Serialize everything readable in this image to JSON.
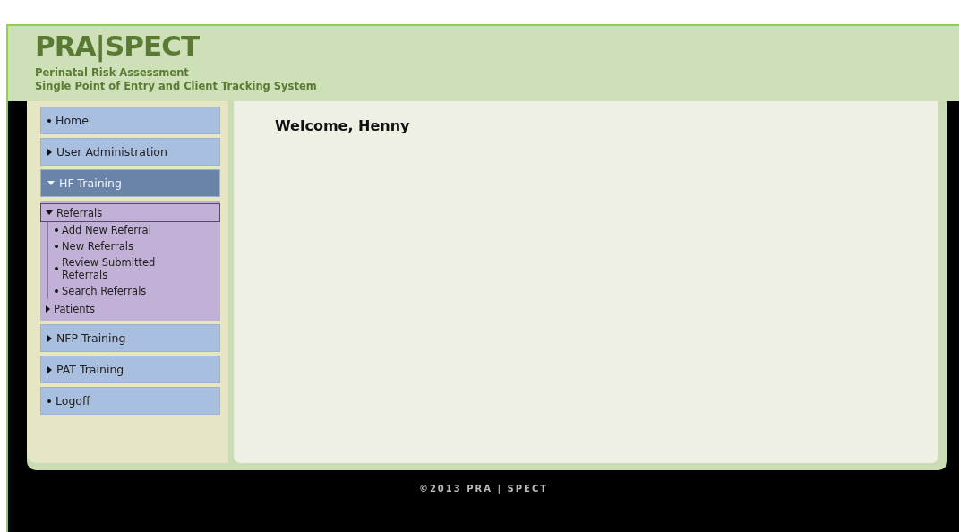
{
  "header": {
    "logo": "PRA|SPECT",
    "subtitle_lines": [
      "Perinatal Risk Assessment",
      "Single Point of Entry and Client Tracking System"
    ]
  },
  "sidebar": {
    "items": [
      {
        "label": "Home",
        "kind": "link"
      },
      {
        "label": "User Administration",
        "kind": "group",
        "expanded": false
      },
      {
        "label": "HF Training",
        "kind": "group",
        "expanded": true,
        "children": [
          {
            "label": "Referrals",
            "kind": "group",
            "expanded": true,
            "children": [
              {
                "label": "Add New Referral",
                "kind": "link"
              },
              {
                "label": "New Referrals",
                "kind": "link"
              },
              {
                "label": "Review Submitted Referrals",
                "kind": "link"
              },
              {
                "label": "Search Referrals",
                "kind": "link"
              }
            ]
          },
          {
            "label": "Patients",
            "kind": "group",
            "expanded": false
          }
        ]
      },
      {
        "label": "NFP Training",
        "kind": "group",
        "expanded": false
      },
      {
        "label": "PAT Training",
        "kind": "group",
        "expanded": false
      },
      {
        "label": "Logoff",
        "kind": "link"
      }
    ]
  },
  "main": {
    "heading": "Welcome, Henny"
  },
  "footer": "©2013 PRA | SPECT"
}
